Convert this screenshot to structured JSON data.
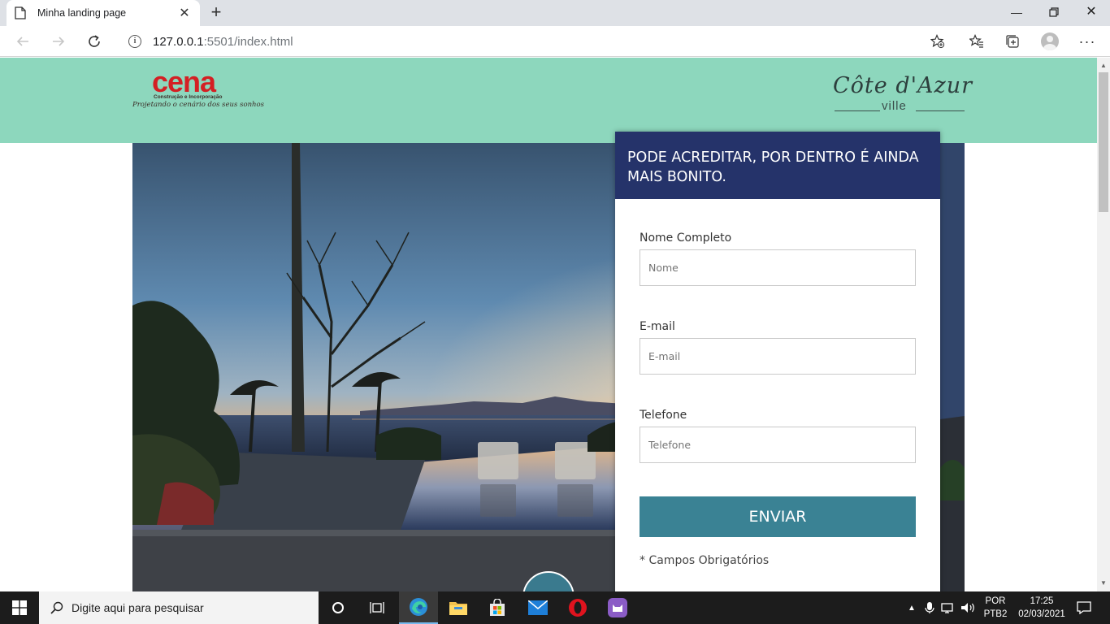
{
  "browser": {
    "tab_title": "Minha landing page",
    "new_tab": "+",
    "url_host": "127.0.0.1",
    "url_path": ":5501/index.html"
  },
  "header": {
    "cena_logo": {
      "word": "cena",
      "sub": "Construção e Incorporação",
      "tagline": "Projetando o cenário dos seus sonhos"
    },
    "cote_logo": {
      "word": "Côte d'Azur",
      "sub": "ville"
    }
  },
  "form": {
    "heading": "PODE ACREDITAR, POR DENTRO É AINDA MAIS BONITO.",
    "fields": [
      {
        "label": "Nome Completo",
        "placeholder": "Nome"
      },
      {
        "label": "E-mail",
        "placeholder": "E-mail"
      },
      {
        "label": "Telefone",
        "placeholder": "Telefone"
      }
    ],
    "submit_label": "ENVIAR",
    "required_note": "* Campos Obrigatórios"
  },
  "taskbar": {
    "search_placeholder": "Digite aqui para pesquisar",
    "lang_line1": "POR",
    "lang_line2": "PTB2",
    "time": "17:25",
    "date": "02/03/2021"
  },
  "colors": {
    "header_bg": "#8dd7bd",
    "form_head_bg": "#25336a",
    "button_bg": "#3a8294",
    "cena_red": "#d41f23"
  }
}
